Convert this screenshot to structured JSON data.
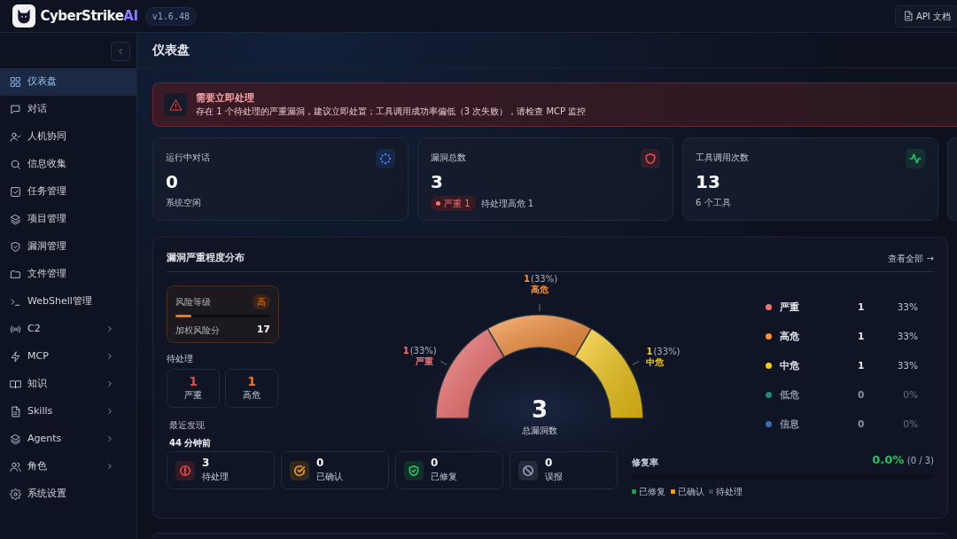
{
  "header": {
    "brand": "CyberStrike",
    "brand_accent": "AI",
    "version": "v1.6.48",
    "api_button": "API 文档"
  },
  "sidebar": {
    "items": [
      {
        "label": "仪表盘",
        "selected": true,
        "submenu": false
      },
      {
        "label": "对话",
        "selected": false,
        "submenu": false
      },
      {
        "label": "人机协同",
        "selected": false,
        "submenu": false
      },
      {
        "label": "信息收集",
        "selected": false,
        "submenu": false
      },
      {
        "label": "任务管理",
        "selected": false,
        "submenu": false
      },
      {
        "label": "项目管理",
        "selected": false,
        "submenu": false
      },
      {
        "label": "漏洞管理",
        "selected": false,
        "submenu": false
      },
      {
        "label": "文件管理",
        "selected": false,
        "submenu": false
      },
      {
        "label": "WebShell管理",
        "selected": false,
        "submenu": false
      },
      {
        "label": "C2",
        "selected": false,
        "submenu": true
      },
      {
        "label": "MCP",
        "selected": false,
        "submenu": true
      },
      {
        "label": "知识",
        "selected": false,
        "submenu": true
      },
      {
        "label": "Skills",
        "selected": false,
        "submenu": true
      },
      {
        "label": "Agents",
        "selected": false,
        "submenu": true
      },
      {
        "label": "角色",
        "selected": false,
        "submenu": true
      },
      {
        "label": "系统设置",
        "selected": false,
        "submenu": false
      }
    ]
  },
  "page_title": "仪表盘",
  "alert": {
    "title": "需要立即处理",
    "message": "存在 1 个待处理的严重漏洞，建议立即处置；工具调用成功率偏低（3 次失败），请检查 MCP 监控"
  },
  "stats": [
    {
      "title": "运行中对话",
      "value": "0",
      "note": "系统空闲",
      "color": "#3b82f6"
    },
    {
      "title": "漏洞总数",
      "value": "3",
      "badge": "严重 1",
      "note": "待处理高危 1",
      "color": "#ef4444"
    },
    {
      "title": "工具调用次数",
      "value": "13",
      "note": "6 个工具",
      "color": "#22c55e"
    }
  ],
  "distribution": {
    "title": "漏洞严重程度分布",
    "view_all": "查看全部 →",
    "risk": {
      "label": "风险等级",
      "level_badge": "高",
      "level": 0.17,
      "score_label": "加权风险分",
      "score": "17"
    },
    "pending_title": "待处理",
    "pending": [
      {
        "count": "1",
        "label": "严重",
        "color": "#ef4444"
      },
      {
        "count": "1",
        "label": "高危",
        "color": "#f97316"
      }
    ],
    "recent_label": "最近发现",
    "recent_value": "44 分钟前",
    "gauge": {
      "total": "3",
      "total_label": "总漏洞数",
      "slice_counts": [
        "1",
        "1",
        "1"
      ],
      "percent_labels": [
        "(33%)",
        "(33%)",
        "(33%)"
      ],
      "chart_data": {
        "type": "donut",
        "categories": [
          "严重",
          "高危",
          "中危"
        ],
        "values": [
          33.34,
          33.33,
          33.33
        ],
        "colors": [
          "#f87171",
          "#fb923c",
          "#facc15"
        ]
      }
    },
    "legend": [
      {
        "name": "严重",
        "count": "1",
        "percent": "33%",
        "color": "#f87171",
        "dimmed": false
      },
      {
        "name": "高危",
        "count": "1",
        "percent": "33%",
        "color": "#fb923c",
        "dimmed": false
      },
      {
        "name": "中危",
        "count": "1",
        "percent": "33%",
        "color": "#facc15",
        "dimmed": false
      },
      {
        "name": "低危",
        "count": "0",
        "percent": "0%",
        "color": "#1f8a78",
        "dimmed": true
      },
      {
        "name": "信息",
        "count": "0",
        "percent": "0%",
        "color": "#3d6db0",
        "dimmed": true
      }
    ],
    "status_boxes": [
      {
        "value": "3",
        "label": "待处理",
        "color": "#ef4444"
      },
      {
        "value": "0",
        "label": "已确认",
        "color": "#f59e0b"
      },
      {
        "value": "0",
        "label": "已修复",
        "color": "#22c55e"
      },
      {
        "value": "0",
        "label": "误报",
        "color": "#94a3b8"
      }
    ],
    "repair": {
      "label": "修复率",
      "rate": "0.0%",
      "fraction": "(0 / 3)",
      "level": 0,
      "legend": [
        {
          "label": "已修复",
          "color": "#16a34a"
        },
        {
          "label": "已确认",
          "color": "#f59e0b"
        },
        {
          "label": "待处理",
          "color": "#334155"
        }
      ]
    }
  }
}
